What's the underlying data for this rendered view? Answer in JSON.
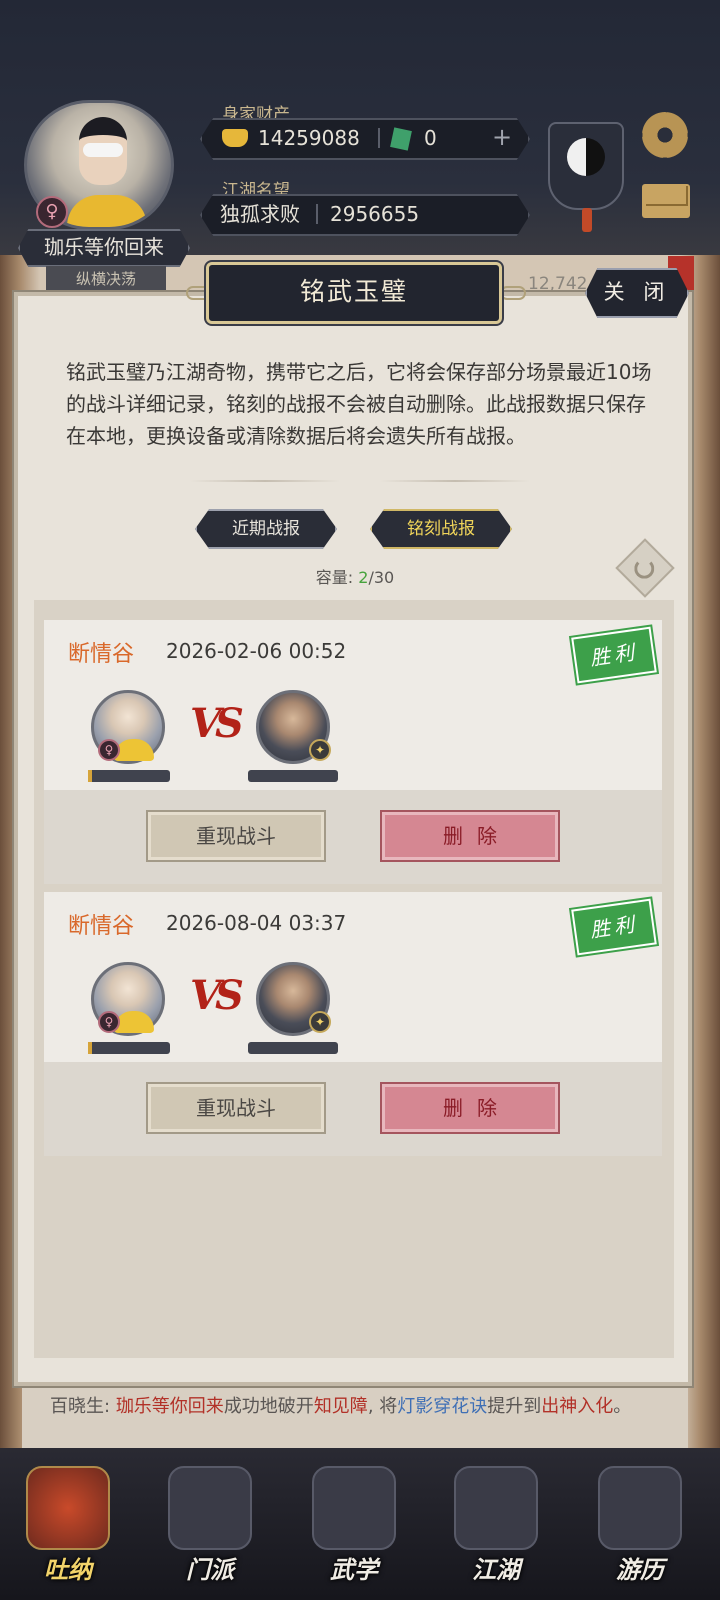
{
  "hud": {
    "wealth_label": "身家财产",
    "gold": "14259088",
    "jade": "0",
    "fame_label": "江湖名望",
    "fame_title": "独孤求败",
    "fame_value": "2956655",
    "player_name": "珈乐等你回来",
    "player_subtitle": "纵横决荡",
    "gender_symbol": "♀",
    "plus": "+",
    "behind_value": "12,742"
  },
  "modal": {
    "title": "铭武玉璧",
    "close_label": "关 闭",
    "description": "铭武玉璧乃江湖奇物，携带它之后，它将会保存部分场景最近10场的战斗详细记录，铭刻的战报不会被自动删除。此战报数据只保存在本地，更换设备或清除数据后将会遗失所有战报。",
    "tabs": {
      "recent": "近期战报",
      "engraved": "铭刻战报"
    },
    "capacity": {
      "label": "容量:",
      "used": "2",
      "total": "/30"
    }
  },
  "records": [
    {
      "scene": "断情谷",
      "date": "2026-02-06 00:52",
      "result": "胜利",
      "vs": "VS",
      "replay_label": "重现战斗",
      "delete_label": "删除"
    },
    {
      "scene": "断情谷",
      "date": "2026-08-04 03:37",
      "result": "胜利",
      "vs": "VS",
      "replay_label": "重现战斗",
      "delete_label": "删除"
    }
  ],
  "chat": {
    "prefix": "百晓生:",
    "player": "珈乐等你回来",
    "text1": "成功地破开",
    "barrier": "知见障",
    "text2": ", 将",
    "skill": "灯影穿花诀",
    "text3": "提升到",
    "level": "出神入化",
    "text4": "。"
  },
  "nav": [
    {
      "label": "吐纳",
      "icon": "meditation-icon"
    },
    {
      "label": "门派",
      "icon": "sect-flag-icon"
    },
    {
      "label": "武学",
      "icon": "scroll-book-icon"
    },
    {
      "label": "江湖",
      "icon": "lantern-icon"
    },
    {
      "label": "游历",
      "icon": "horse-icon"
    }
  ],
  "colors": {
    "accent_gold": "#f0d55a",
    "scene_orange": "#d9682a",
    "win_green": "#3da04a",
    "delete_red": "#d58792"
  }
}
